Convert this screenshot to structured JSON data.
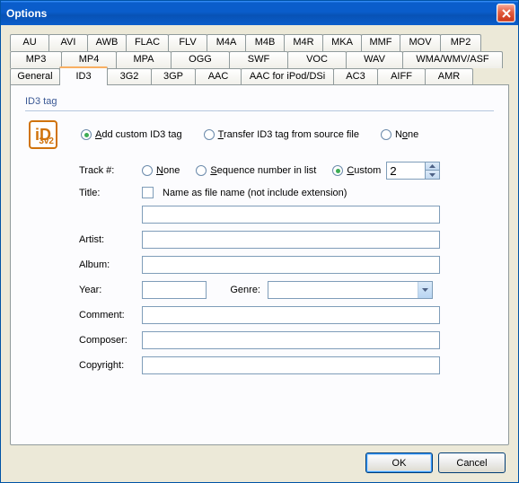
{
  "window": {
    "title": "Options"
  },
  "tabs_row1": [
    "AU",
    "AVI",
    "AWB",
    "FLAC",
    "FLV",
    "M4A",
    "M4B",
    "M4R",
    "MKA",
    "MMF",
    "MOV",
    "MP2"
  ],
  "tabs_row2": [
    "MP3",
    "MP4",
    "MPA",
    "OGG",
    "SWF",
    "VOC",
    "WAV",
    "WMA/WMV/ASF"
  ],
  "tabs_row3": [
    "General",
    "ID3",
    "3G2",
    "3GP",
    "AAC",
    "AAC for iPod/DSi",
    "AC3",
    "AIFF",
    "AMR"
  ],
  "active_tab_row": 3,
  "active_tab_index": 1,
  "group_label": "ID3 tag",
  "icon": {
    "big": "iD",
    "small": "3v2"
  },
  "modes": [
    {
      "label_pre": "",
      "ul": "A",
      "label_post": "dd custom ID3 tag",
      "checked": true
    },
    {
      "label_pre": "",
      "ul": "T",
      "label_post": "ransfer ID3 tag from source file",
      "checked": false
    },
    {
      "label_pre": "N",
      "ul": "o",
      "label_post": "ne",
      "checked": false
    }
  ],
  "tracknum": {
    "label": "Track #:",
    "options": [
      {
        "ul": "N",
        "post": "one",
        "checked": false
      },
      {
        "ul": "S",
        "post": "equence number in list",
        "checked": false
      },
      {
        "ul": "C",
        "post": "ustom",
        "checked": true
      }
    ],
    "custom_value": "2"
  },
  "title_field": {
    "label": "Title:",
    "checkbox_label": "Name as file name (not include extension)",
    "checked": false,
    "value": ""
  },
  "fields": {
    "artist": {
      "label": "Artist:",
      "value": ""
    },
    "album": {
      "label": "Album:",
      "value": ""
    },
    "year": {
      "label": "Year:",
      "value": ""
    },
    "genre": {
      "label": "Genre:",
      "value": ""
    },
    "comment": {
      "label": "Comment:",
      "value": ""
    },
    "composer": {
      "label": "Composer:",
      "value": ""
    },
    "copyright": {
      "label": "Copyright:",
      "value": ""
    }
  },
  "buttons": {
    "ok": "OK",
    "cancel": "Cancel"
  }
}
